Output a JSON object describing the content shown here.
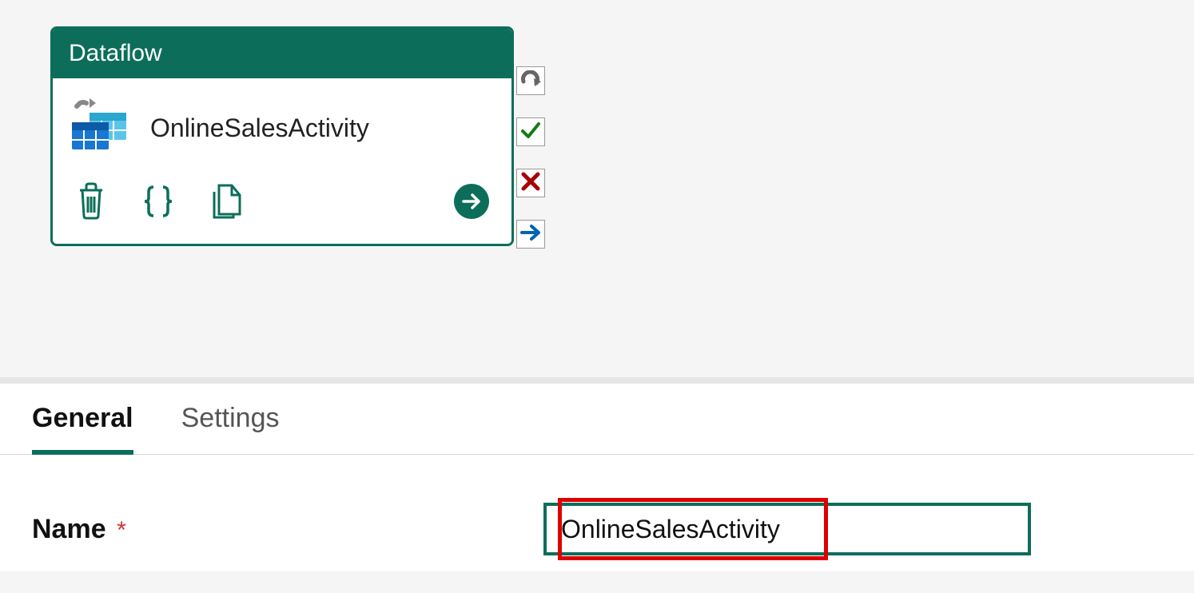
{
  "activity": {
    "type_label": "Dataflow",
    "name": "OnlineSalesActivity",
    "icons": {
      "dataflow": "dataflow-icon",
      "delete": "trash-icon",
      "code": "braces-icon",
      "copy": "copy-icon",
      "proceed": "arrow-circle-icon"
    }
  },
  "handles": {
    "retry": "retry-icon",
    "success": "check-icon",
    "failure": "x-icon",
    "skip": "arrow-right-icon"
  },
  "tabs": [
    {
      "id": "general",
      "label": "General",
      "active": true
    },
    {
      "id": "settings",
      "label": "Settings",
      "active": false
    }
  ],
  "form": {
    "name_label": "Name",
    "required_indicator": "*",
    "name_value": "OnlineSalesActivity"
  },
  "colors": {
    "primary": "#0c6e5a",
    "danger": "#a80000",
    "highlight": "#d00"
  }
}
